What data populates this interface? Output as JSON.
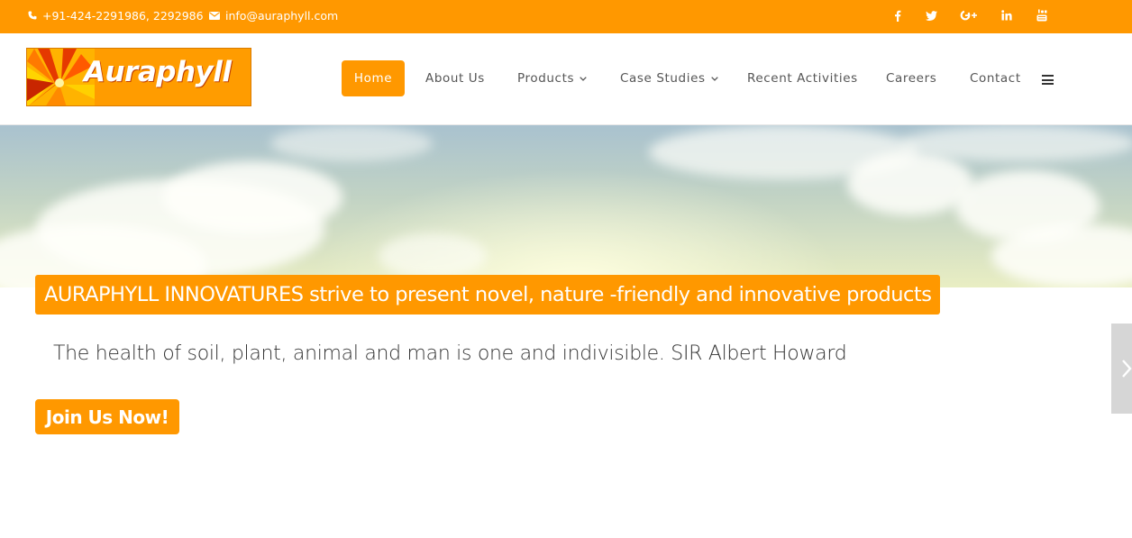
{
  "topbar": {
    "phone": "+91-424-2291986, 2292986",
    "email": "info@auraphyll.com",
    "social": [
      {
        "icon": "facebook-icon",
        "glyph": "f"
      },
      {
        "icon": "twitter-icon",
        "glyph": "t"
      },
      {
        "icon": "google-plus-icon",
        "glyph": "G+"
      },
      {
        "icon": "linkedin-icon",
        "glyph": "in"
      },
      {
        "icon": "youtube-icon",
        "glyph": "You Tube"
      }
    ]
  },
  "header": {
    "logo_text": "Auraphyll",
    "nav": [
      {
        "label": "Home",
        "active": true
      },
      {
        "label": "About Us"
      },
      {
        "label": "Products",
        "has_dropdown": true
      },
      {
        "label": "Case Studies",
        "has_dropdown": true
      },
      {
        "label": "Recent Activities"
      },
      {
        "label": "Careers"
      },
      {
        "label": "Contact"
      }
    ]
  },
  "hero": {
    "headline": "AURAPHYLL INNOVATURES strive to present novel, nature -friendly and innovative products",
    "quote": "The health of soil, plant, animal and man is one and indivisible. SIR Albert Howard",
    "cta_label": "Join Us Now!"
  },
  "colors": {
    "accent": "#ff9800",
    "text": "#555555",
    "dark_text": "#333333"
  }
}
